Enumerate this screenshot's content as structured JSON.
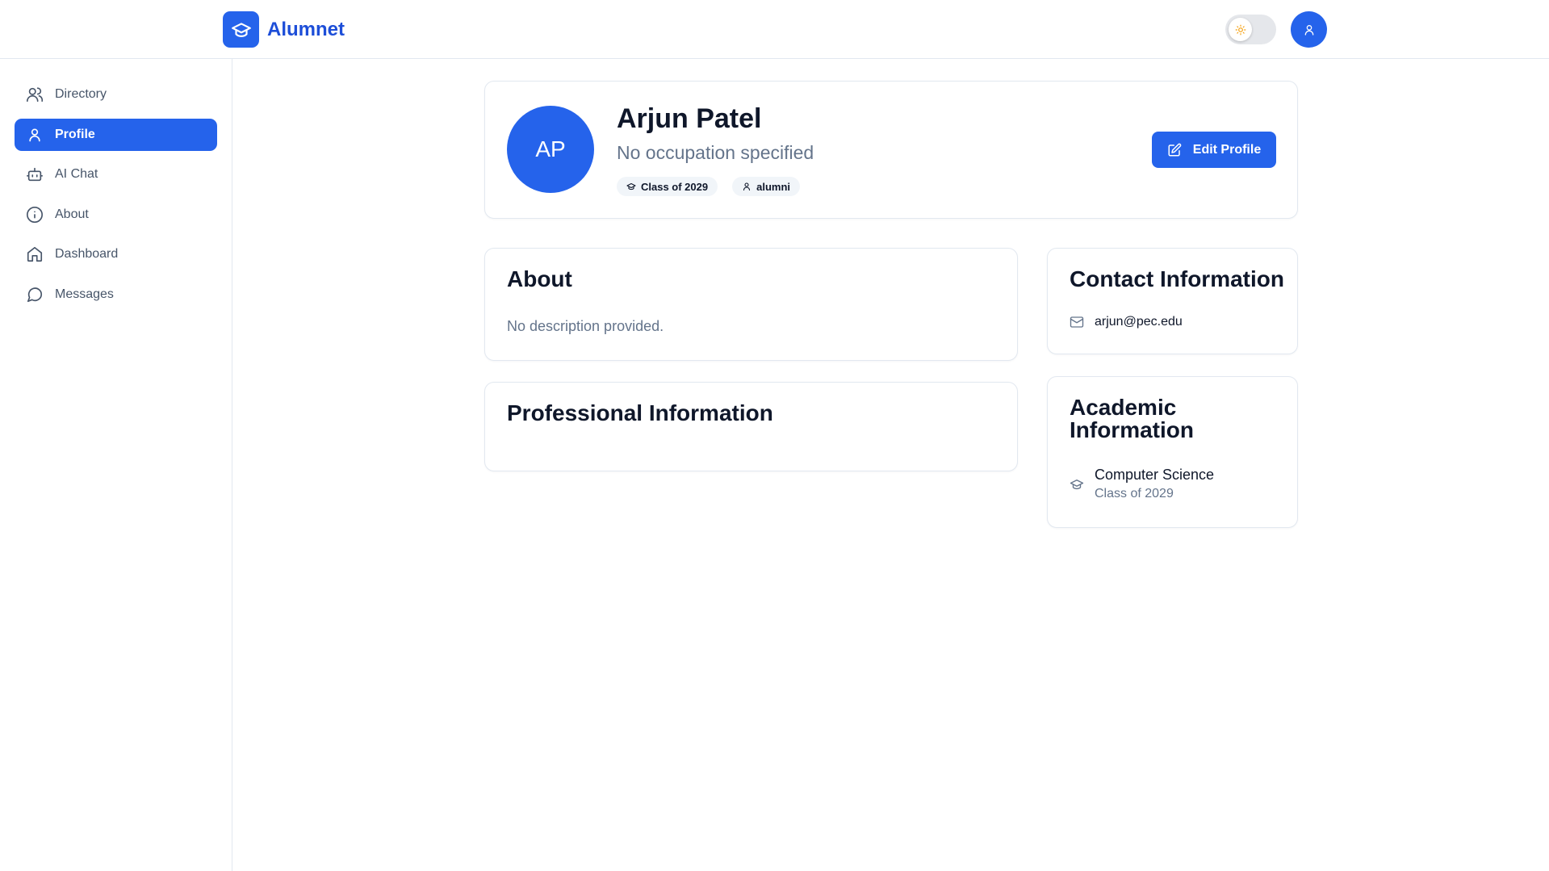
{
  "app": {
    "name": "Alumnet"
  },
  "header": {
    "logo_icon": "graduation-cap-icon",
    "theme_icon": "sun-icon",
    "user_icon": "user-icon"
  },
  "sidebar": {
    "items": [
      {
        "label": "Directory",
        "icon": "users-icon",
        "active": false
      },
      {
        "label": "Profile",
        "icon": "user-icon",
        "active": true
      },
      {
        "label": "AI Chat",
        "icon": "bot-icon",
        "active": false
      },
      {
        "label": "About",
        "icon": "info-icon",
        "active": false
      },
      {
        "label": "Dashboard",
        "icon": "home-icon",
        "active": false
      },
      {
        "label": "Messages",
        "icon": "message-circle-icon",
        "active": false
      }
    ]
  },
  "profile": {
    "initials": "AP",
    "name": "Arjun Patel",
    "occupation": "No occupation specified",
    "badges": [
      {
        "label": "Class of 2029",
        "icon": "graduation-cap-icon"
      },
      {
        "label": "alumni",
        "icon": "user-icon"
      }
    ],
    "edit_label": "Edit Profile"
  },
  "about": {
    "title": "About",
    "text": "No description provided."
  },
  "professional": {
    "title": "Professional Information"
  },
  "contact": {
    "title": "Contact Information",
    "email": "arjun@pec.edu"
  },
  "academic": {
    "title_line1": "Academic",
    "title_line2": "Information",
    "major": "Computer Science",
    "class": "Class of 2029"
  },
  "colors": {
    "accent": "#2563eb",
    "muted": "#64748b",
    "border": "#e2e8f0"
  }
}
